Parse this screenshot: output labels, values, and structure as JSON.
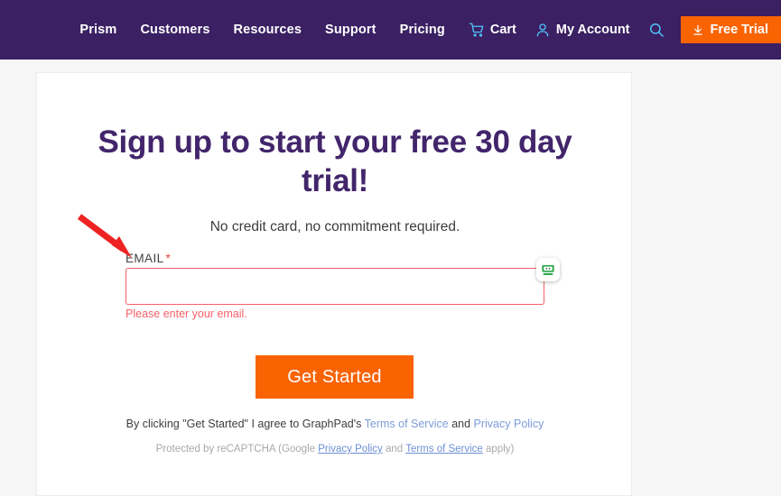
{
  "nav": {
    "links": [
      {
        "label": "Prism"
      },
      {
        "label": "Customers"
      },
      {
        "label": "Resources"
      },
      {
        "label": "Support"
      },
      {
        "label": "Pricing"
      }
    ],
    "cart_label": "Cart",
    "account_label": "My Account",
    "search_icon": "search-icon",
    "cart_icon": "shopping-cart-icon",
    "account_icon": "user-person-icon",
    "free_trial_label": "Free Trial",
    "free_trial_icon": "download-arrow-icon",
    "background_color": "#3b2063",
    "accent_color": "#f96302",
    "icon_color": "#4fc3f7"
  },
  "main": {
    "headline": "Sign up to start your free 30 day trial!",
    "subheadline": "No credit card, no commitment required.",
    "headline_color": "#42256b",
    "form": {
      "email_label": "EMAIL",
      "required_marker": "*",
      "email_value": "",
      "email_placeholder": "",
      "error_message": "Please enter your email.",
      "error_color": "#f4606a",
      "autofill_icon": "roboform-autofill-icon",
      "submit_label": "Get Started",
      "submit_color": "#f96302"
    },
    "legal": {
      "prefix": "By clicking \"Get Started\" I agree to GraphPad's ",
      "terms_label": "Terms of Service",
      "conjunction": " and ",
      "privacy_label": "Privacy Policy",
      "link_color": "#7c9cd8"
    },
    "recaptcha": {
      "prefix": "Protected by reCAPTCHA (Google ",
      "privacy_label": "Privacy Policy",
      "conjunction": " and ",
      "terms_label": "Terms of Service",
      "suffix": " apply)"
    }
  },
  "annotation": {
    "arrow_color": "#ee2222",
    "arrow_name": "red-pointer-arrow"
  }
}
